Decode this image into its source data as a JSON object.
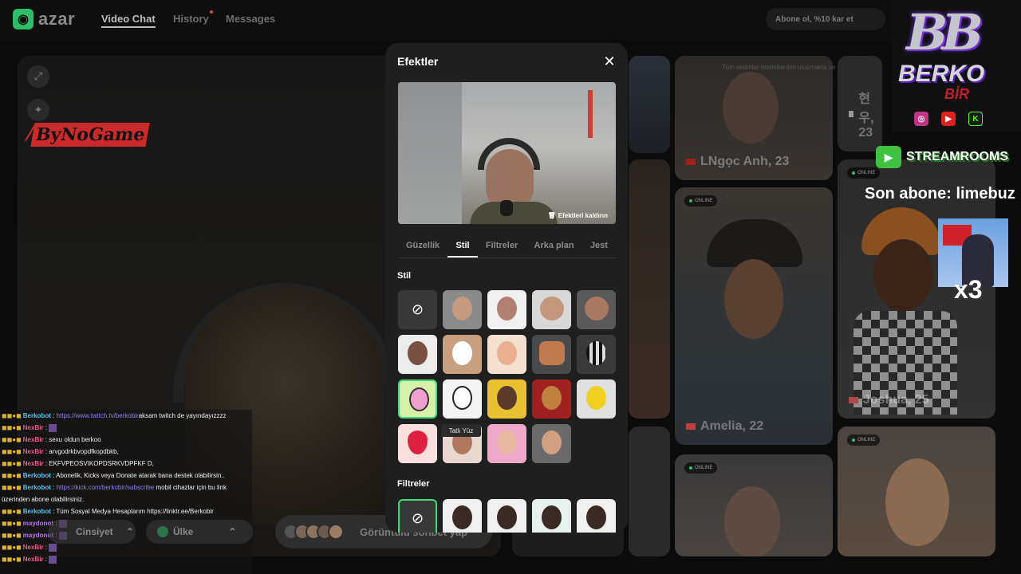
{
  "app": {
    "brand": "azar"
  },
  "nav": {
    "video_chat": "Video Chat",
    "history": "History",
    "messages": "Messages"
  },
  "subscribe_button": "Abone ol, %10 kar et",
  "left_panel": {
    "bynogame_logo": "ByNoGame"
  },
  "chat": [
    {
      "user": "Berkobot",
      "type": "berko",
      "text": "aksam twitch de yayındayızzzz ",
      "link": "https://www.twitch.tv/berkobir"
    },
    {
      "user": "NexBir",
      "type": "nex",
      "text": "",
      "emote": true
    },
    {
      "user": "NexBir",
      "type": "nex",
      "text": "sexu oldun berkoo"
    },
    {
      "user": "NexBir",
      "type": "nex",
      "text": "arvgodrkbvopdfkopdbkb,"
    },
    {
      "user": "NexBir",
      "type": "nex",
      "text": "EKFVPEOSVIKOPDSRKVDPFKF D,"
    },
    {
      "user": "Berkobot",
      "type": "berko",
      "text": "Abonelik, Kicks veya Donate atarak bana destek olabilirsin.."
    },
    {
      "user": "Berkobot",
      "type": "berko",
      "text": " mobil cihazlar için bu link",
      "link": "https://kick.com/berkobir/subscribe"
    },
    {
      "user": "",
      "type": "plain",
      "text": "üzerinden abone olabilirsiniz."
    },
    {
      "user": "Berkobot",
      "type": "berko",
      "text": "Tüm Sosyal Medya Hesaplarım https://linktr.ee/Berkobir"
    },
    {
      "user": "maydonot",
      "type": "may",
      "text": "",
      "emote": true
    },
    {
      "user": "maydonot",
      "type": "may",
      "text": "",
      "emote": true
    },
    {
      "user": "NexBir",
      "type": "nex",
      "text": "",
      "emote": true
    },
    {
      "user": "NexBir",
      "type": "nex",
      "text": "",
      "emote": true
    }
  ],
  "bottom_controls": {
    "gender": "Cinsiyet",
    "country": "Ülke",
    "start_chat": "Görüntülü sohbet yap"
  },
  "cards": [
    {
      "name": "LNgọc Anh, 23"
    },
    {
      "name": "현우, 23"
    },
    {
      "name": "Amelia, 22",
      "online": "ONLINE"
    },
    {
      "name": "Joshua, 25",
      "online": "ONLINE"
    },
    {
      "name": "",
      "online": "ONLINE"
    },
    {
      "name": "",
      "online": "ONLINE"
    }
  ],
  "card_notice": "Tüm resimler modellerden oluşmakta ve sadece",
  "overlay": {
    "bb": "BB",
    "berko": "BERKO",
    "bir": "BİR",
    "social_k": "K",
    "streamrooms": "STREAMROOMS",
    "last_sub": "Son abone: limebuz",
    "multiplier": "x3"
  },
  "modal": {
    "title": "Efektler",
    "remove_effects": "Efektleri kaldırın",
    "tabs": [
      "Güzellik",
      "Stil",
      "Filtreler",
      "Arka plan",
      "Jest"
    ],
    "active_tab": "Stil",
    "style_section": "Stil",
    "filters_section": "Filtreler",
    "tooltip": "Tatlı Yüz"
  },
  "colors": {
    "accent": "#3adf7a",
    "brand": "#2bbf6a"
  }
}
